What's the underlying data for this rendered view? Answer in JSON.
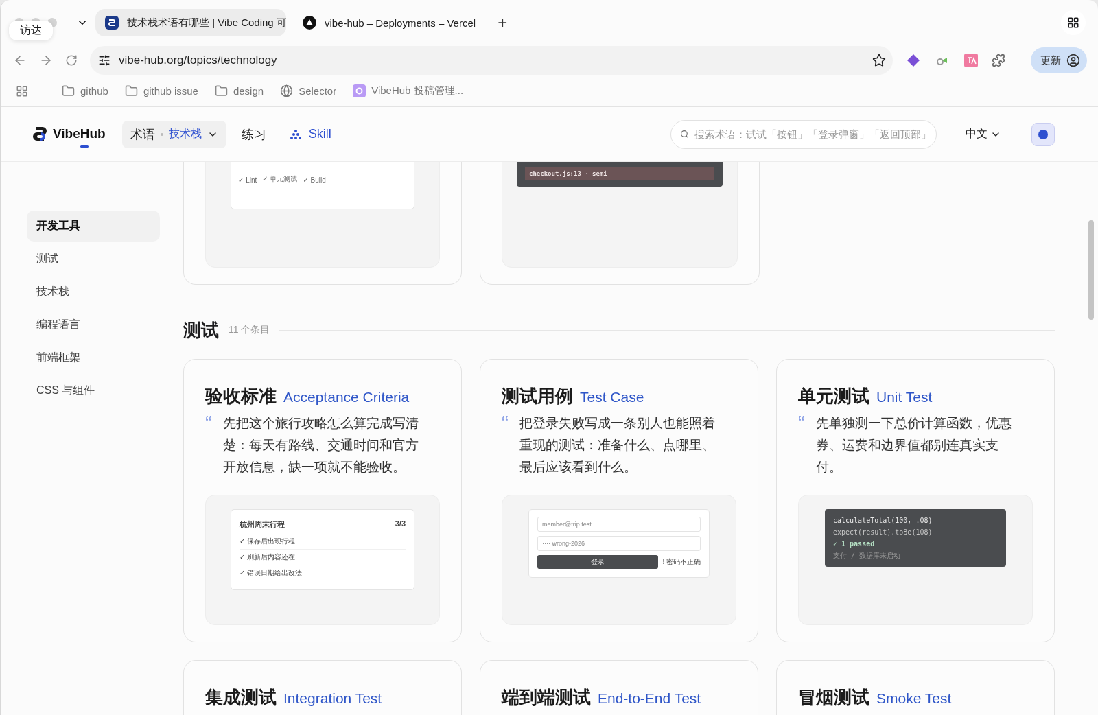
{
  "browser": {
    "tooltip": "访达",
    "tabs": [
      {
        "title": "技术栈术语有哪些 | Vibe Coding 可",
        "selected": true
      },
      {
        "title": "vibe-hub – Deployments – Vercel",
        "selected": false
      }
    ],
    "new_tab": "+",
    "url": "vibe-hub.org/topics/technology",
    "update_button": "更新",
    "bookmarks": [
      {
        "label": "github",
        "kind": "folder"
      },
      {
        "label": "github issue",
        "kind": "folder"
      },
      {
        "label": "design",
        "kind": "folder"
      },
      {
        "label": "Selector",
        "kind": "globe"
      },
      {
        "label": "VibeHub 投稿管理...",
        "kind": "app"
      }
    ]
  },
  "header": {
    "logo": "VibeHub",
    "nav": [
      {
        "kind": "dropdown",
        "label": "术语",
        "sub": "技术栈",
        "selected": true
      },
      {
        "kind": "link",
        "label": "练习",
        "selected": false
      },
      {
        "kind": "skill",
        "label": "Skill",
        "selected": false
      }
    ],
    "search": {
      "placeholder": "搜索术语：试试「按钮」「登录弹窗」「返回顶部」"
    },
    "language": "中文"
  },
  "sidebar": {
    "items": [
      {
        "label": "开发工具",
        "selected": true
      },
      {
        "label": "测试",
        "selected": false
      },
      {
        "label": "技术栈",
        "selected": false
      },
      {
        "label": "编程语言",
        "selected": false
      },
      {
        "label": "前端框架",
        "selected": false
      },
      {
        "label": "CSS 与组件",
        "selected": false
      }
    ]
  },
  "top_cards": [
    {
      "kind": "checks",
      "items": [
        "✓ Lint",
        "✓ 单元测试",
        "✓ Build"
      ]
    },
    {
      "kind": "error",
      "line": "checkout.js:13 · semi"
    }
  ],
  "section": {
    "title": "测试",
    "count": "11 个条目"
  },
  "cards": [
    {
      "zh": "验收标准",
      "en": "Acceptance Criteria",
      "quote_mark": "“",
      "text": "先把这个旅行攻略怎么算完成写清楚：每天有路线、交通时间和官方开放信息，缺一项就不能验收。",
      "preview": {
        "kind": "checklist",
        "title": "杭州周末行程",
        "count": "3/3",
        "items": [
          "✓ 保存后出现行程",
          "✓ 刷新后内容还在",
          "✓ 错误日期给出改法"
        ]
      }
    },
    {
      "zh": "测试用例",
      "en": "Test Case",
      "quote_mark": "“",
      "text": "把登录失败写成一条别人也能照着重现的测试：准备什么、点哪里、最后应该看到什么。",
      "preview": {
        "kind": "login",
        "email": "member@trip.test",
        "password": "···· wrong-2026",
        "button": "登录",
        "error": "! 密码不正确"
      }
    },
    {
      "zh": "单元测试",
      "en": "Unit Test",
      "quote_mark": "“",
      "text": "先单独测一下总价计算函数，优惠券、运费和边界值都别连真实支付。",
      "preview": {
        "kind": "code",
        "lines": [
          {
            "kind": "code",
            "text": "calculateTotal(100, .08)"
          },
          {
            "kind": "dim",
            "text": "expect(result).toBe(108)"
          },
          {
            "kind": "pass",
            "text": "✓ 1 passed"
          },
          {
            "kind": "muted",
            "text": "支付 / 数据库未启动"
          }
        ]
      }
    }
  ],
  "next_cards": [
    {
      "zh": "集成测试",
      "en": "Integration Test"
    },
    {
      "zh": "端到端测试",
      "en": "End-to-End Test"
    },
    {
      "zh": "冒烟测试",
      "en": "Smoke Test"
    }
  ]
}
